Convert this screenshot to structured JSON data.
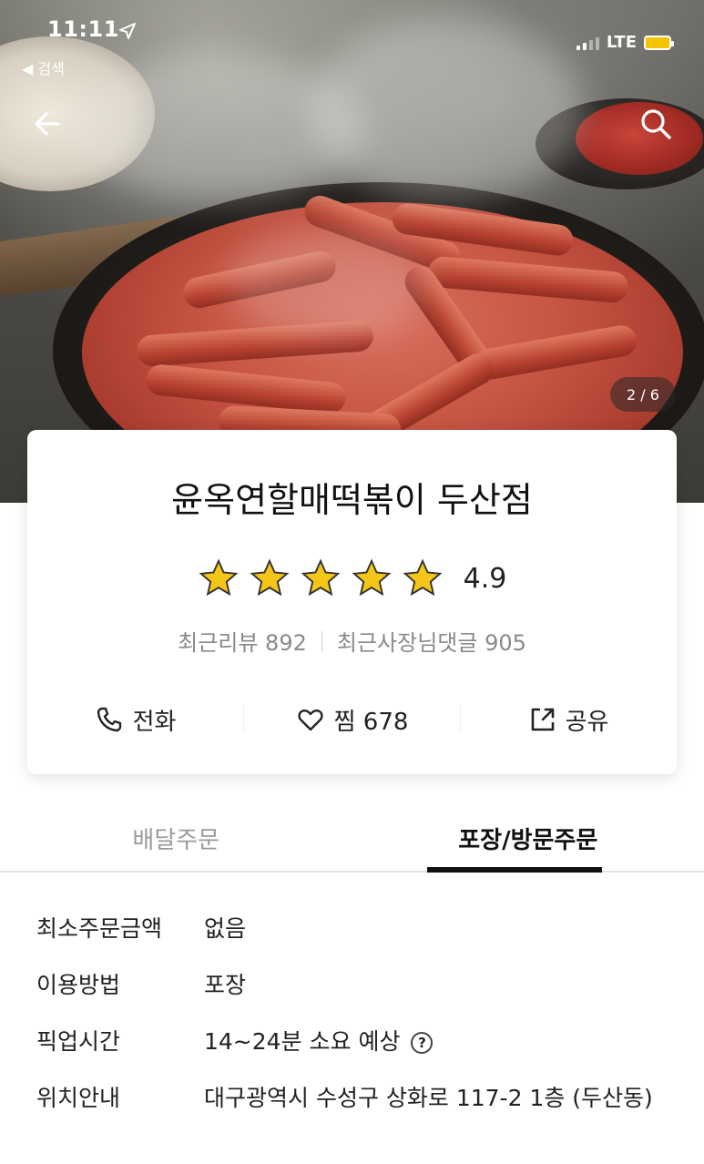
{
  "status_bar": {
    "time": "11:11",
    "back_app": "◀ 검색",
    "network": "LTE"
  },
  "hero": {
    "page_indicator": "2 / 6"
  },
  "store": {
    "name": "윤옥연할매떡볶이 두산점",
    "rating": "4.9",
    "rating_stars": 5,
    "recent_reviews": "최근리뷰 892",
    "owner_replies": "최근사장님댓글 905"
  },
  "actions": {
    "call_label": "전화",
    "favorite_label": "찜 678",
    "share_label": "공유"
  },
  "tabs": [
    {
      "label": "배달주문",
      "active": false
    },
    {
      "label": "포장/방문주문",
      "active": true
    }
  ],
  "details": [
    {
      "label": "최소주문금액",
      "value": "없음"
    },
    {
      "label": "이용방법",
      "value": "포장"
    },
    {
      "label": "픽업시간",
      "value": "14~24분 소요 예상"
    },
    {
      "label": "위치안내",
      "value": "대구광역시 수성구 상화로 117-2 1층 (두산동)"
    }
  ],
  "colors": {
    "star": "#f5c518",
    "battery": "#f5c400",
    "active_tab": "#111111",
    "inactive_tab": "#9a9a9a"
  },
  "icons": {
    "back": "arrow-left-icon",
    "search": "search-icon",
    "call": "phone-icon",
    "favorite": "heart-icon",
    "share": "share-icon",
    "help": "question-circle-icon"
  }
}
